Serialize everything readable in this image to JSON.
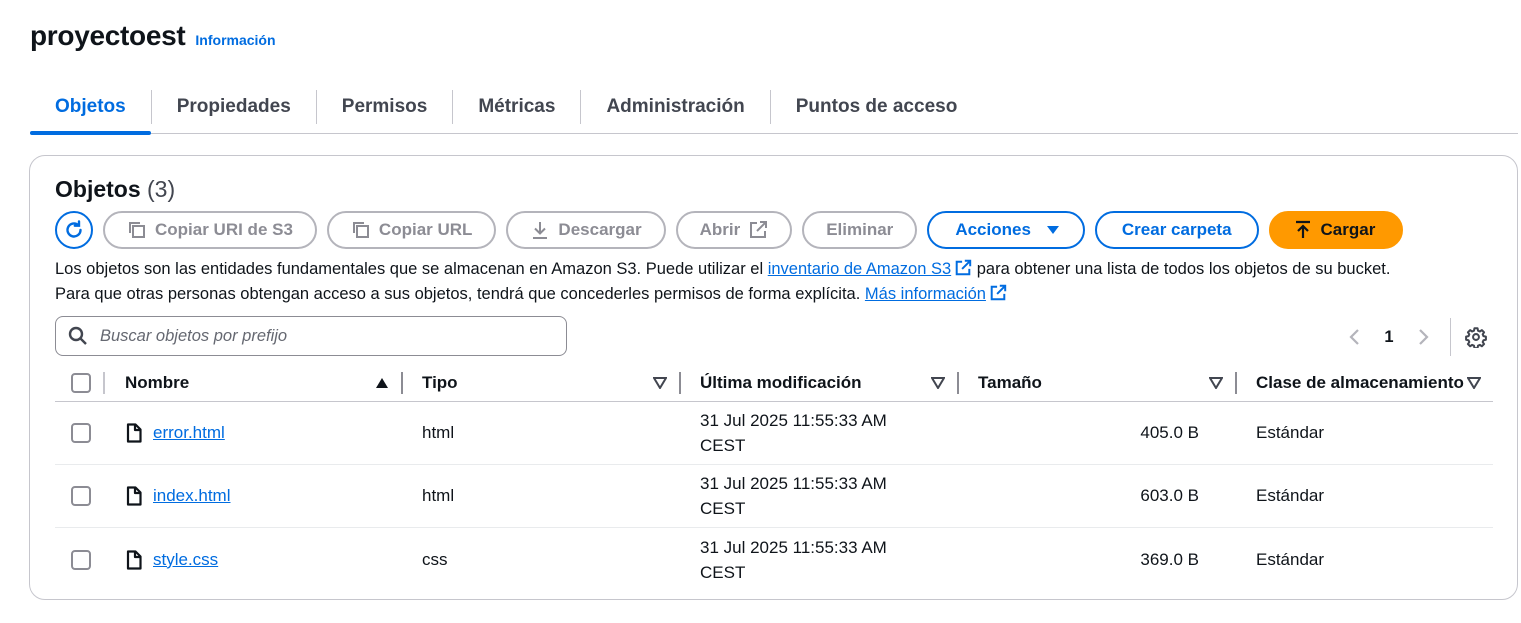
{
  "header": {
    "title": "proyectoest",
    "info": "Información"
  },
  "tabs": [
    {
      "label": "Objetos",
      "active": true
    },
    {
      "label": "Propiedades"
    },
    {
      "label": "Permisos"
    },
    {
      "label": "Métricas"
    },
    {
      "label": "Administración"
    },
    {
      "label": "Puntos de acceso"
    }
  ],
  "panel": {
    "title": "Objetos",
    "count": "(3)"
  },
  "toolbar": {
    "copy_uri": "Copiar URI de S3",
    "copy_url": "Copiar URL",
    "download": "Descargar",
    "open": "Abrir",
    "delete": "Eliminar",
    "actions": "Acciones",
    "create_folder": "Crear carpeta",
    "upload": "Cargar"
  },
  "description": {
    "line1_pre": "Los objetos son las entidades fundamentales que se almacenan en Amazon S3. Puede utilizar el ",
    "line1_link": "inventario de Amazon S3",
    "line1_post": " para obtener una lista de todos los objetos de su bucket.",
    "line2_pre": "Para que otras personas obtengan acceso a sus objetos, tendrá que concederles permisos de forma explícita. ",
    "line2_link": "Más información"
  },
  "search": {
    "placeholder": "Buscar objetos por prefijo",
    "value": ""
  },
  "pagination": {
    "current_page": "1"
  },
  "table": {
    "columns": {
      "name": "Nombre",
      "type": "Tipo",
      "modified": "Última modificación",
      "size": "Tamaño",
      "storage_class": "Clase de almacenamiento"
    },
    "rows": [
      {
        "name": "error.html",
        "type": "html",
        "date": "31 Jul 2025 11:55:33 AM",
        "tz": "CEST",
        "size": "405.0 B",
        "storage_class": "Estándar"
      },
      {
        "name": "index.html",
        "type": "html",
        "date": "31 Jul 2025 11:55:33 AM",
        "tz": "CEST",
        "size": "603.0 B",
        "storage_class": "Estándar"
      },
      {
        "name": "style.css",
        "type": "css",
        "date": "31 Jul 2025 11:55:33 AM",
        "tz": "CEST",
        "size": "369.0 B",
        "storage_class": "Estándar"
      }
    ]
  },
  "colors": {
    "accent": "#006ce0",
    "upload": "#ff9900",
    "text": "#0f141a",
    "border": "#c6c6cd"
  },
  "icons": [
    "refresh-icon",
    "copy-icon",
    "download-icon",
    "external-link-icon",
    "caret-down-icon",
    "upload-icon",
    "search-icon",
    "chevron-left-icon",
    "chevron-right-icon",
    "gear-icon",
    "sort-ascending-icon",
    "sort-descending-icon",
    "file-icon"
  ]
}
